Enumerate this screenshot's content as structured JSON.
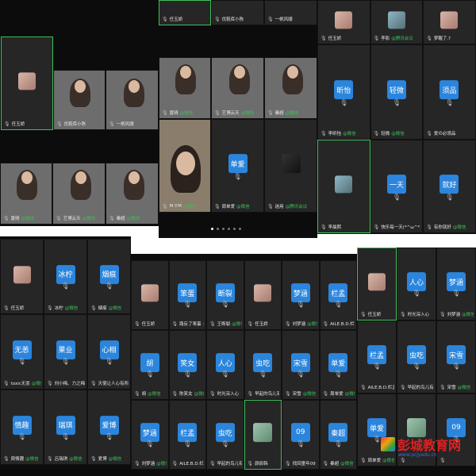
{
  "s1": [
    {
      "name": "任玉娇",
      "src": "",
      "kind": "photo",
      "active": true
    },
    {
      "name": "优鞋库小陈",
      "src": "",
      "kind": "photo2"
    },
    {
      "name": "一帆风顺",
      "src": "",
      "kind": "photo2"
    }
  ],
  "s1_top": [
    {
      "name": "任玉娇",
      "src": ""
    },
    {
      "name": "优鞋库小陈",
      "src": ""
    },
    {
      "name": "一帆风顺",
      "src": ""
    }
  ],
  "s2": [
    {
      "name": "任玉娇",
      "src": "",
      "kind": "photo"
    },
    {
      "name": "李影",
      "src": "@腾讯会议",
      "kind": "photo2"
    },
    {
      "name": "梦醒了.?",
      "src": "",
      "kind": "photo"
    },
    {
      "name": "李昕怡",
      "src": "@微信",
      "av": "昕怡",
      "kind": "blue"
    },
    {
      "name": "轻微",
      "src": "@微信",
      "av": "轻微",
      "kind": "blue"
    },
    {
      "name": "爱の必须品",
      "src": "",
      "av": "须品",
      "kind": "blue"
    },
    {
      "name": "李晨熙",
      "src": "",
      "kind": "photo2",
      "active": true
    },
    {
      "name": "快乐每一天(*^ω^*)",
      "src": "",
      "av": "一天",
      "kind": "blue"
    },
    {
      "name": "有你就好",
      "src": "@微信",
      "av": "就好",
      "kind": "blue"
    }
  ],
  "s3": [
    {
      "name": "夏晴",
      "src": "@微信"
    },
    {
      "name": "艺博云天",
      "src": "@微信"
    },
    {
      "name": "秦超",
      "src": "@微信"
    }
  ],
  "s3b": [
    {
      "name": "夏晴",
      "src": "@微信"
    },
    {
      "name": "艺博云天",
      "src": "@微信"
    },
    {
      "name": "秦超",
      "src": "@微信"
    }
  ],
  "s4": [
    {
      "name": "M.Y.M",
      "src": "@微信",
      "kind": "face"
    },
    {
      "name": "周单爱",
      "src": "@微信",
      "av": "单爱",
      "kind": "blue"
    },
    {
      "name": "迷用",
      "src": "@腾讯会议",
      "kind": "dark"
    }
  ],
  "s5": [
    {
      "name": "任玉娇",
      "src": "",
      "kind": "photo"
    },
    {
      "name": "冰柠",
      "src": "@微信",
      "av": "冰柠",
      "kind": "blue"
    },
    {
      "name": "烟痕",
      "src": "@微信",
      "av": "烟痕",
      "kind": "blue"
    },
    {
      "name": "toxic无恙",
      "src": "@微信",
      "av": "无恙",
      "kind": "blue"
    },
    {
      "name": "刘小梅、力之梅果…",
      "src": "",
      "av": "果业",
      "kind": "blue"
    },
    {
      "name": "天使让人心有所想…",
      "src": "",
      "av": "心相",
      "kind": "blue"
    },
    {
      "name": "周情趣",
      "src": "@微信",
      "av": "情趣",
      "kind": "blue"
    },
    {
      "name": "吕瑞琪",
      "src": "@微信",
      "av": "瑞琪",
      "kind": "blue"
    },
    {
      "name": "爱博",
      "src": "@微信",
      "av": "爱博",
      "kind": "blue"
    }
  ],
  "s6": [
    {
      "name": "任玉娇",
      "src": "",
      "kind": "photo"
    },
    {
      "name": "路反了笨蛋",
      "src": "@微信",
      "av": "笨蛋",
      "kind": "blue"
    },
    {
      "name": "王断裂",
      "src": "@微信",
      "av": "断裂",
      "kind": "blue"
    },
    {
      "name": "任玉娇",
      "src": "",
      "kind": "photo"
    },
    {
      "name": "刘梦涵",
      "src": "@微信",
      "av": "梦涵",
      "kind": "blue"
    },
    {
      "name": "AILE.B.D.栏孟",
      "src": "",
      "av": "栏孟",
      "kind": "blue"
    },
    {
      "name": "胡",
      "src": "@微信",
      "av": "胡",
      "kind": "blue"
    },
    {
      "name": "陈笑女",
      "src": "@微信",
      "av": "笑女",
      "kind": "blue"
    },
    {
      "name": "时光深入心",
      "src": "",
      "av": "人心",
      "kind": "blue"
    },
    {
      "name": "早起的鸟儿有虫吃",
      "src": "",
      "av": "虫吃",
      "kind": "blue"
    },
    {
      "name": "宋雪",
      "src": "@微信",
      "av": "宋雪",
      "kind": "blue"
    },
    {
      "name": "周单爱",
      "src": "@微信",
      "av": "单爱",
      "kind": "blue"
    },
    {
      "name": "刘梦涵",
      "src": "@微信",
      "av": "梦涵",
      "kind": "blue"
    },
    {
      "name": "AILE.B.D.栏孟",
      "src": "",
      "av": "栏孟",
      "kind": "blue"
    },
    {
      "name": "早起的鸟儿有虫吃",
      "src": "",
      "av": "虫吃",
      "kind": "blue"
    },
    {
      "name": "颜辰韩",
      "src": "",
      "kind": "cat",
      "active": true
    },
    {
      "name": "找回童年09",
      "src": "",
      "av": "09",
      "kind": "blue"
    },
    {
      "name": "秦超",
      "src": "@微信",
      "av": "秦超",
      "kind": "blue"
    }
  ],
  "s7": [
    {
      "name": "任玉娇",
      "src": "",
      "kind": "photo",
      "active": true
    },
    {
      "name": "时光深入心",
      "src": "",
      "av": "人心",
      "kind": "blue"
    },
    {
      "name": "刘梦涵",
      "src": "@微信",
      "av": "梦涵",
      "kind": "blue"
    },
    {
      "name": "AILE.B.D.栏孟",
      "src": "",
      "av": "栏孟",
      "kind": "blue"
    },
    {
      "name": "早起的鸟儿有虫吃",
      "src": "",
      "av": "虫吃",
      "kind": "blue"
    },
    {
      "name": "宋雪",
      "src": "@微信",
      "av": "宋雪",
      "kind": "blue"
    },
    {
      "name": "周单爱",
      "src": "@微信",
      "av": "单爱",
      "kind": "blue"
    },
    {
      "name": "",
      "src": "",
      "kind": "cat"
    },
    {
      "name": "",
      "src": "",
      "av": "09",
      "kind": "blue"
    }
  ],
  "watermark": {
    "name": "彭城教育网",
    "url": "www.pcjyedu.cn"
  }
}
